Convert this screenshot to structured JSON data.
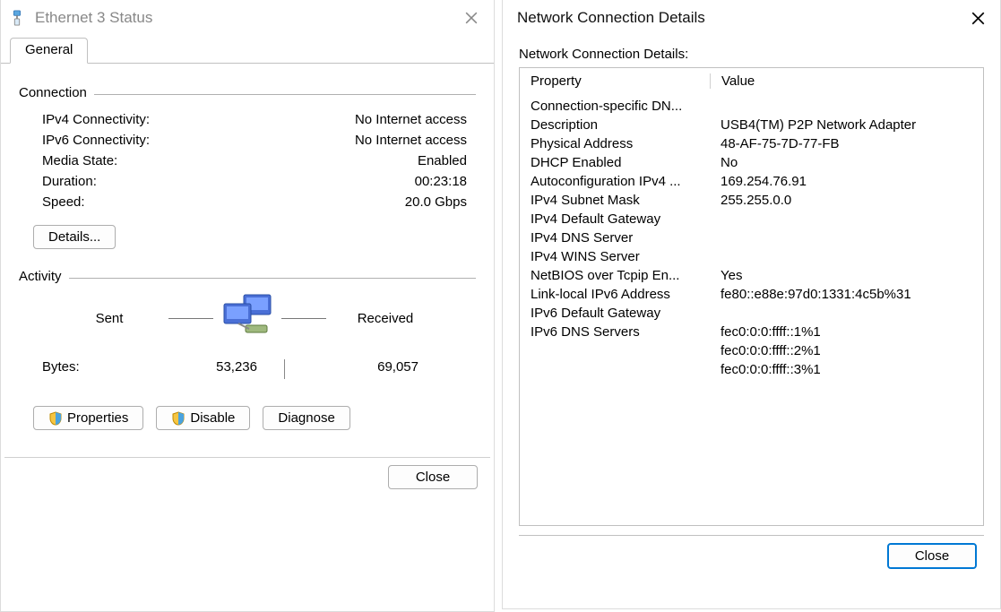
{
  "status": {
    "title": "Ethernet 3 Status",
    "tab": "General",
    "groups": {
      "connection": {
        "title": "Connection",
        "rows": {
          "ipv4": {
            "label": "IPv4 Connectivity:",
            "value": "No Internet access"
          },
          "ipv6": {
            "label": "IPv6 Connectivity:",
            "value": "No Internet access"
          },
          "media": {
            "label": "Media State:",
            "value": "Enabled"
          },
          "duration": {
            "label": "Duration:",
            "value": "00:23:18"
          },
          "speed": {
            "label": "Speed:",
            "value": "20.0 Gbps"
          }
        },
        "details_btn": "Details..."
      },
      "activity": {
        "title": "Activity",
        "sent_label": "Sent",
        "received_label": "Received",
        "bytes_label": "Bytes:",
        "sent_bytes": "53,236",
        "received_bytes": "69,057"
      }
    },
    "buttons": {
      "properties": "Properties",
      "disable": "Disable",
      "diagnose": "Diagnose",
      "close": "Close"
    }
  },
  "details": {
    "title": "Network Connection Details",
    "caption": "Network Connection Details:",
    "head": {
      "property": "Property",
      "value": "Value"
    },
    "rows": [
      {
        "p": "Connection-specific DN...",
        "v": ""
      },
      {
        "p": "Description",
        "v": "USB4(TM) P2P Network Adapter"
      },
      {
        "p": "Physical Address",
        "v": "48-AF-75-7D-77-FB"
      },
      {
        "p": "DHCP Enabled",
        "v": "No"
      },
      {
        "p": "Autoconfiguration IPv4 ...",
        "v": "169.254.76.91"
      },
      {
        "p": "IPv4 Subnet Mask",
        "v": "255.255.0.0"
      },
      {
        "p": "IPv4 Default Gateway",
        "v": ""
      },
      {
        "p": "IPv4 DNS Server",
        "v": ""
      },
      {
        "p": "IPv4 WINS Server",
        "v": ""
      },
      {
        "p": "NetBIOS over Tcpip En...",
        "v": "Yes"
      },
      {
        "p": "Link-local IPv6 Address",
        "v": "fe80::e88e:97d0:1331:4c5b%31"
      },
      {
        "p": "IPv6 Default Gateway",
        "v": ""
      },
      {
        "p": "IPv6 DNS Servers",
        "v": "fec0:0:0:ffff::1%1"
      },
      {
        "p": "",
        "v": "fec0:0:0:ffff::2%1"
      },
      {
        "p": "",
        "v": "fec0:0:0:ffff::3%1"
      }
    ],
    "close_btn": "Close"
  }
}
